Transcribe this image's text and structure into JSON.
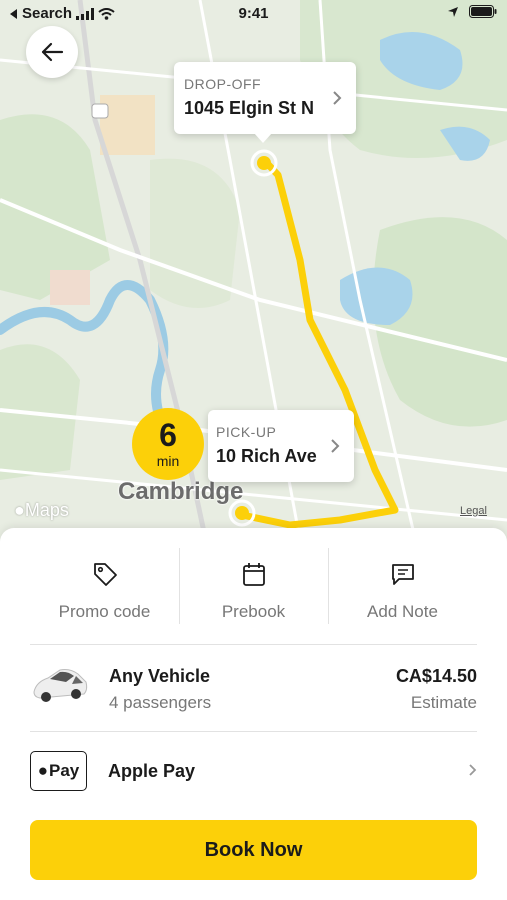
{
  "status_bar": {
    "back_label": "Search",
    "time": "9:41"
  },
  "map": {
    "dropoff_label": "DROP-OFF",
    "dropoff_address": "1045 Elgin St N",
    "pickup_label": "PICK-UP",
    "pickup_address": "10 Rich Ave",
    "eta_value": "6",
    "eta_unit": "min",
    "city_label": "Cambridge",
    "maps_brand": "Maps",
    "legal_link": "Legal",
    "route_color": "#fcd009"
  },
  "actions": [
    {
      "label": "Promo code",
      "icon": "tag-icon"
    },
    {
      "label": "Prebook",
      "icon": "calendar-icon"
    },
    {
      "label": "Add Note",
      "icon": "note-icon"
    }
  ],
  "vehicle": {
    "name": "Any Vehicle",
    "passengers": "4 passengers",
    "price": "CA$14.50",
    "price_note": "Estimate"
  },
  "payment": {
    "badge_text": "Pay",
    "method": "Apple Pay"
  },
  "book_button": {
    "label": "Book Now"
  },
  "colors": {
    "accent": "#fcd009",
    "text": "#1b1b1b",
    "muted": "#777777"
  }
}
